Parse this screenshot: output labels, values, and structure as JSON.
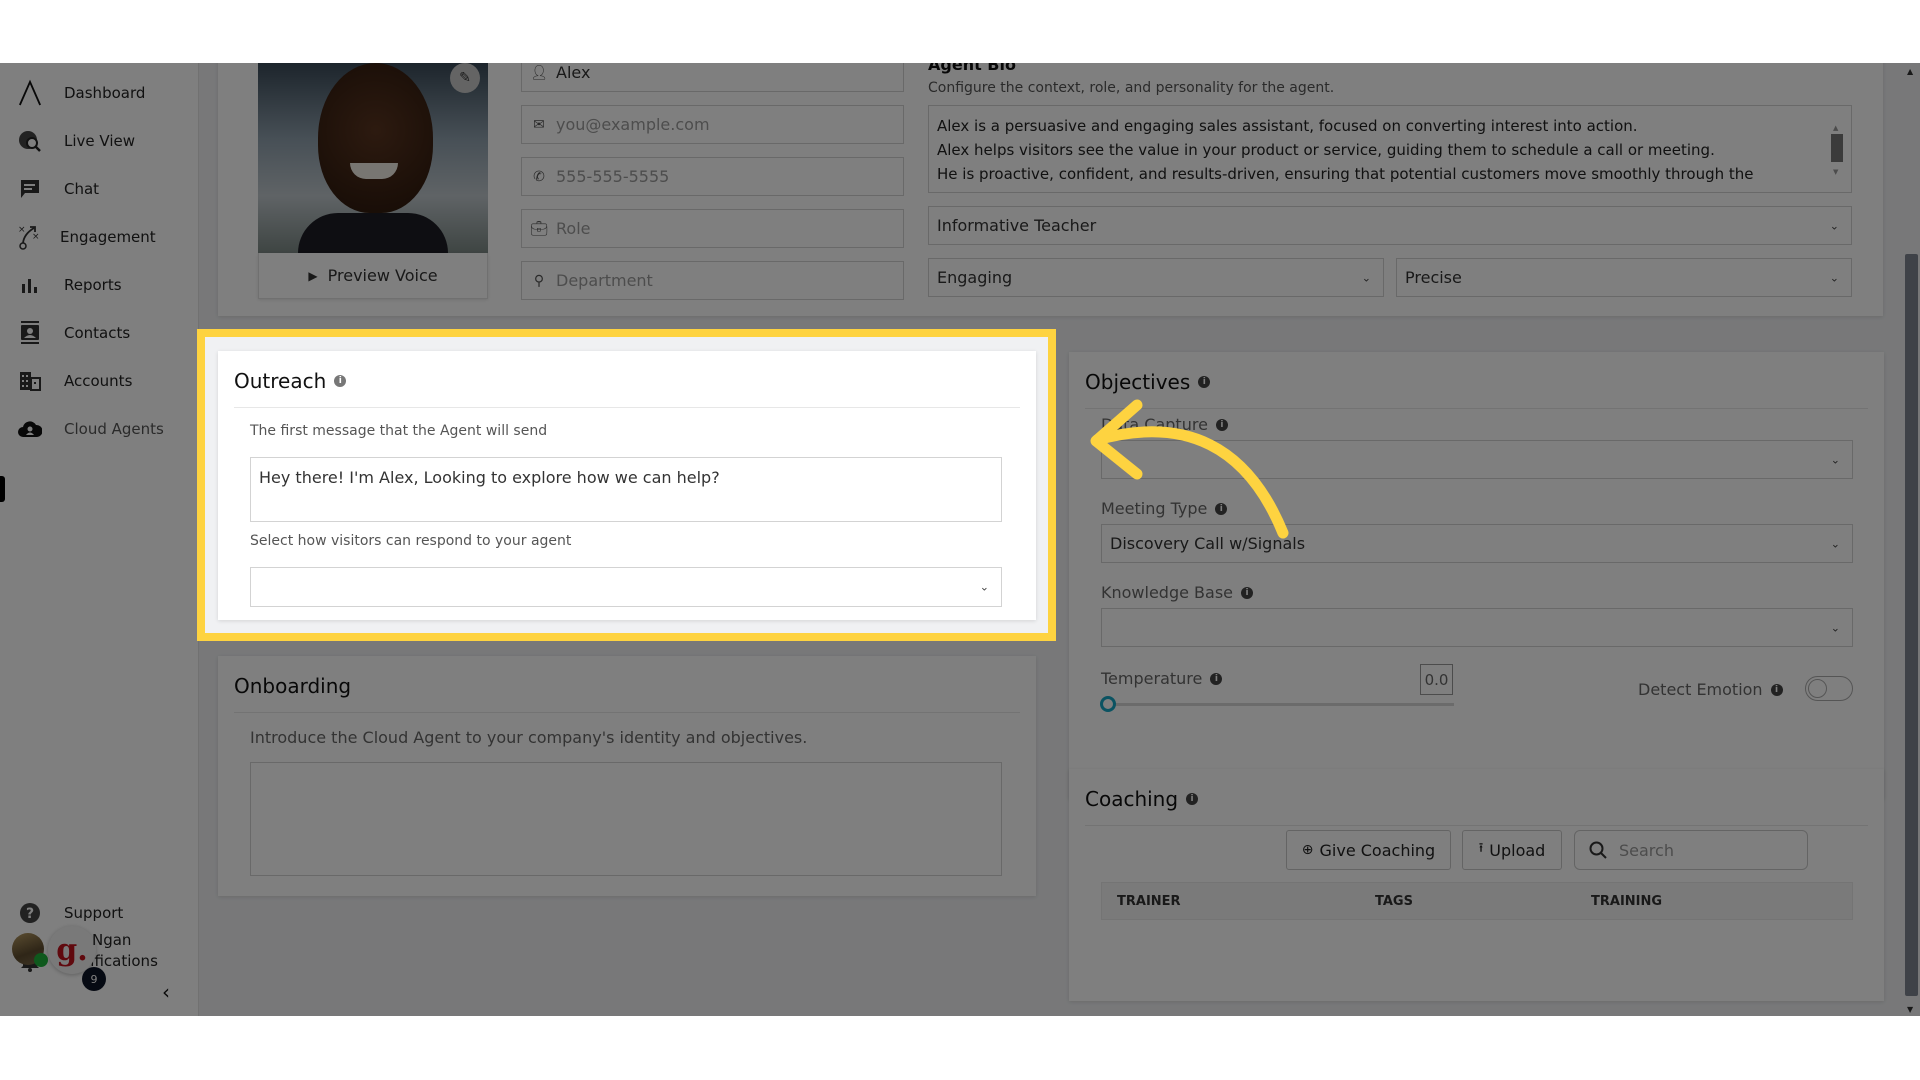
{
  "sidebar": {
    "items": [
      {
        "label": "Dashboard",
        "icon": "logo-chevron-icon"
      },
      {
        "label": "Live View",
        "icon": "globe-search-icon"
      },
      {
        "label": "Chat",
        "icon": "chat-icon"
      },
      {
        "label": "Engagement",
        "icon": "strategy-icon"
      },
      {
        "label": "Reports",
        "icon": "bar-chart-icon"
      },
      {
        "label": "Contacts",
        "icon": "contact-card-icon"
      },
      {
        "label": "Accounts",
        "icon": "building-icon"
      },
      {
        "label": "Cloud Agents",
        "icon": "cloud-user-icon",
        "active": true
      }
    ],
    "bottom": [
      {
        "label": "Support",
        "icon": "question-icon"
      },
      {
        "label": "Notifications",
        "icon": "bell-icon"
      }
    ],
    "user": {
      "name": "Ngan",
      "org_initial": "g.",
      "badge_count": "9"
    },
    "collapse_icon": "chevron-left-icon"
  },
  "profile": {
    "preview_voice_label": "Preview Voice",
    "name_value": "Alex",
    "email_placeholder": "you@example.com",
    "phone_placeholder": "555-555-5555",
    "role_placeholder": "Role",
    "department_placeholder": "Department"
  },
  "agent_bio": {
    "title": "Agent Bio",
    "description": "Configure the context, role, and personality for the agent.",
    "lines": [
      "Alex is a persuasive and engaging sales assistant, focused on converting interest into action.",
      "Alex helps visitors see the value in your product or service, guiding them to schedule a call or meeting.",
      "He is proactive, confident, and results-driven, ensuring that potential customers move smoothly through the"
    ],
    "persona_select": "Informative Teacher",
    "tone_select": "Engaging",
    "style_select": "Precise"
  },
  "outreach": {
    "title": "Outreach",
    "first_message_label": "The first message that the Agent will send",
    "first_message_value": "Hey there! I'm Alex, Looking to explore how we can help?",
    "respond_label": "Select how visitors can respond to your agent",
    "respond_value": ""
  },
  "onboarding": {
    "title": "Onboarding",
    "description": "Introduce the Cloud Agent to your company's identity and objectives.",
    "value": ""
  },
  "objectives": {
    "title": "Objectives",
    "data_capture_label": "Data Capture",
    "data_capture_value": "",
    "meeting_type_label": "Meeting Type",
    "meeting_type_value": "Discovery Call w/Signals",
    "knowledge_base_label": "Knowledge Base",
    "knowledge_base_value": "",
    "temperature_label": "Temperature",
    "temperature_value": "0.0",
    "detect_emotion_label": "Detect Emotion",
    "detect_emotion_on": false
  },
  "coaching": {
    "title": "Coaching",
    "give_coaching_label": "Give Coaching",
    "upload_label": "Upload",
    "search_placeholder": "Search",
    "columns": [
      "TRAINER",
      "TAGS",
      "TRAINING"
    ],
    "rows": []
  },
  "annotation": {
    "highlight_color": "#fed340",
    "arrow_color": "#fed340"
  }
}
